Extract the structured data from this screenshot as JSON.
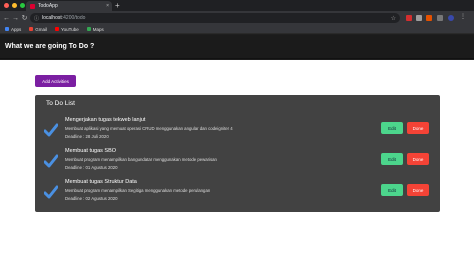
{
  "browser": {
    "tab_title": "TodoApp",
    "tab_close": "×",
    "new_tab": "+",
    "url_host": "localhost",
    "url_path": ":4200/todo",
    "bookmarks": [
      {
        "label": "Apps",
        "color": "#4285f4"
      },
      {
        "label": "Gmail",
        "color": "#ea4335"
      },
      {
        "label": "YouTube",
        "color": "#ff0000"
      },
      {
        "label": "Maps",
        "color": "#34a853"
      }
    ],
    "nav_icons": [
      "back-icon",
      "forward-icon",
      "reload-icon"
    ]
  },
  "app": {
    "header_title": "What we are going To Do ?",
    "add_button": "Add Activities",
    "list_title": "To Do List",
    "edit_label": "Edit",
    "done_label": "Done",
    "todos": [
      {
        "title": "Mengerjakan tugas tekweb lanjut",
        "description": "Membuat aplikasi yang memuat operasi CRUD menggunakan angular dan codeigniter 4",
        "deadline": "Deadline : 28 Juli 2020"
      },
      {
        "title": "Membuat tugas SBO",
        "description": "Membuat program menampilkan bangundatar menggunakan metode pewarisan",
        "deadline": "Deadline : 01 Agustus 2020"
      },
      {
        "title": "Membuat tugas Struktur Data",
        "description": "Membuat program menampilkan Segitiga menggunakan metode perulangan",
        "deadline": "Deadline : 02 Agustus 2020"
      }
    ]
  },
  "colors": {
    "accent": "#7b1fa2",
    "edit": "#4cd58c",
    "done": "#f44336",
    "card": "#424242"
  }
}
